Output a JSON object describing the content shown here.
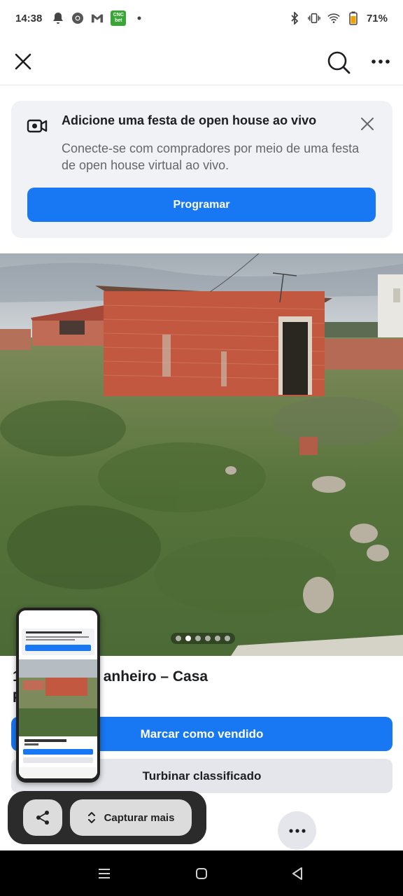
{
  "status": {
    "time": "14:38",
    "battery": "71%",
    "left_icons": [
      "notification-bell-icon",
      "chrome-icon",
      "gmail-icon",
      "cncbet-app-icon",
      "dot-icon"
    ],
    "right_icons": [
      "bluetooth-icon",
      "vibrate-icon",
      "wifi-icon",
      "battery-icon"
    ],
    "cnc_label_top": "CNC",
    "cnc_label_bottom": "bet"
  },
  "nav": {
    "icons": [
      "close-icon",
      "search-icon",
      "more-icon"
    ]
  },
  "open_house": {
    "title": "Adicione uma festa de open house ao vivo",
    "description": "Conecte-se com compradores por meio de uma festa de open house virtual ao vivo.",
    "button": "Programar",
    "icon": "live-video-icon"
  },
  "photo": {
    "total_photos": 6,
    "active_index": 1
  },
  "listing": {
    "title_visible_part1": "1",
    "title_visible_part2": "anheiro – Casa",
    "title_line2": "P",
    "primary_button": "Marcar como vendido",
    "secondary_button": "Turbinar classificado"
  },
  "capture": {
    "capture_more": "Capturar mais",
    "share_icon": "share-icon"
  },
  "colors": {
    "brand_blue": "#1877f2",
    "card_bg": "#f0f2f5",
    "secondary_btn": "#e4e6eb"
  }
}
